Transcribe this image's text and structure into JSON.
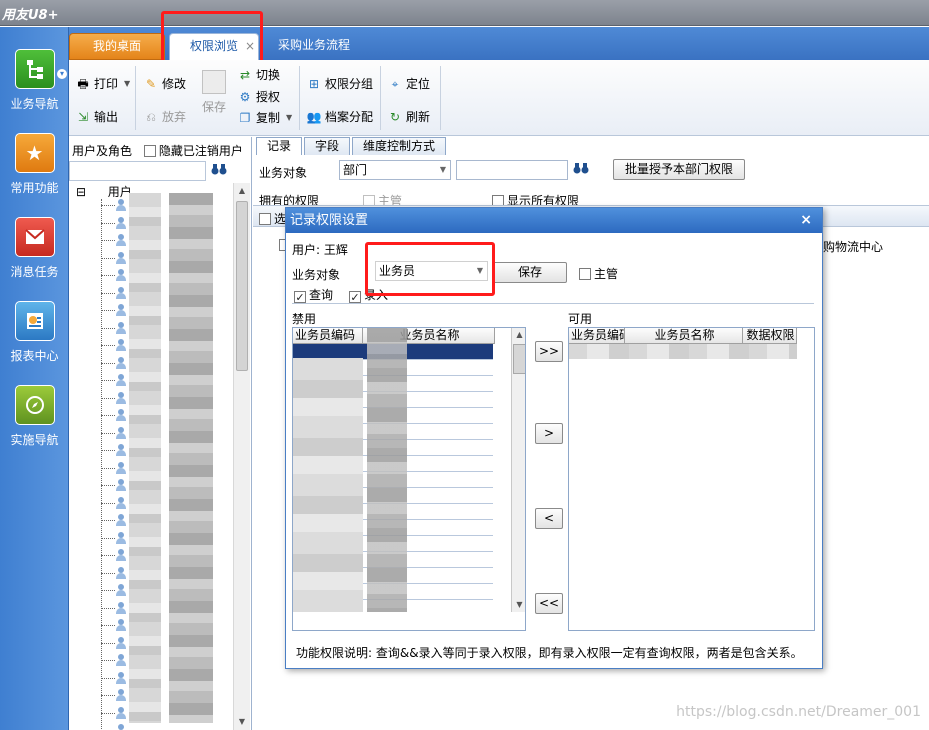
{
  "app": {
    "logo_text": "用友U8+"
  },
  "leftnav": {
    "items": [
      {
        "label": "业务导航",
        "icon": "flowchart-icon"
      },
      {
        "label": "常用功能",
        "icon": "star-folder-icon"
      },
      {
        "label": "消息任务",
        "icon": "mail-task-icon"
      },
      {
        "label": "报表中心",
        "icon": "report-icon"
      },
      {
        "label": "实施导航",
        "icon": "compass-icon"
      }
    ],
    "expand_symbol": "▾"
  },
  "tabs": [
    {
      "label": "我的桌面"
    },
    {
      "label": "权限浏览",
      "close": "×"
    },
    {
      "label": "采购业务流程"
    }
  ],
  "toolbar": {
    "print": "打印",
    "export": "输出",
    "modify": "修改",
    "discard": "放弃",
    "save": "保存",
    "switch": "切换",
    "authorize": "授权",
    "copy": "复制",
    "perm_group": "权限分组",
    "archive_assign": "档案分配",
    "locate": "定位",
    "refresh": "刷新"
  },
  "userpanel": {
    "header": "用户及角色",
    "hide_cancelled_label": "隐藏已注销用户",
    "root_label": "用户",
    "root_expander": "⊟"
  },
  "main": {
    "subtabs": [
      "记录",
      "字段",
      "维度控制方式"
    ],
    "business_object_label": "业务对象",
    "business_object_value": "部门",
    "batch_grant_button": "批量授予本部门权限",
    "owned_perm_label": "拥有的权限",
    "supervisor_label": "主管",
    "show_all_label": "显示所有权限",
    "grid_check_label": "选",
    "row_text": "购物流中心"
  },
  "dialog": {
    "title": "记录权限设置",
    "close": "×",
    "user_label": "用户: 王辉",
    "business_object_label": "业务对象",
    "business_object_value": "业务员",
    "save_button": "保存",
    "supervisor_label": "主管",
    "query_label": "查询",
    "entry_label": "录入",
    "forbidden_label": "禁用",
    "available_label": "可用",
    "left_col_code": "业务员编码",
    "left_col_name": "业务员名称",
    "right_col_code": "业务员编码",
    "right_col_name": "业务员名称",
    "right_col_perm": "数据权限",
    "btn_move_all_right": ">>",
    "btn_move_right": ">",
    "btn_move_left": "<",
    "btn_move_all_left": "<<",
    "note": "功能权限说明: 查询&&录入等同于录入权限，即有录入权限一定有查询权限，两者是包含关系。"
  },
  "watermark": "https://blog.csdn.net/Dreamer_001"
}
